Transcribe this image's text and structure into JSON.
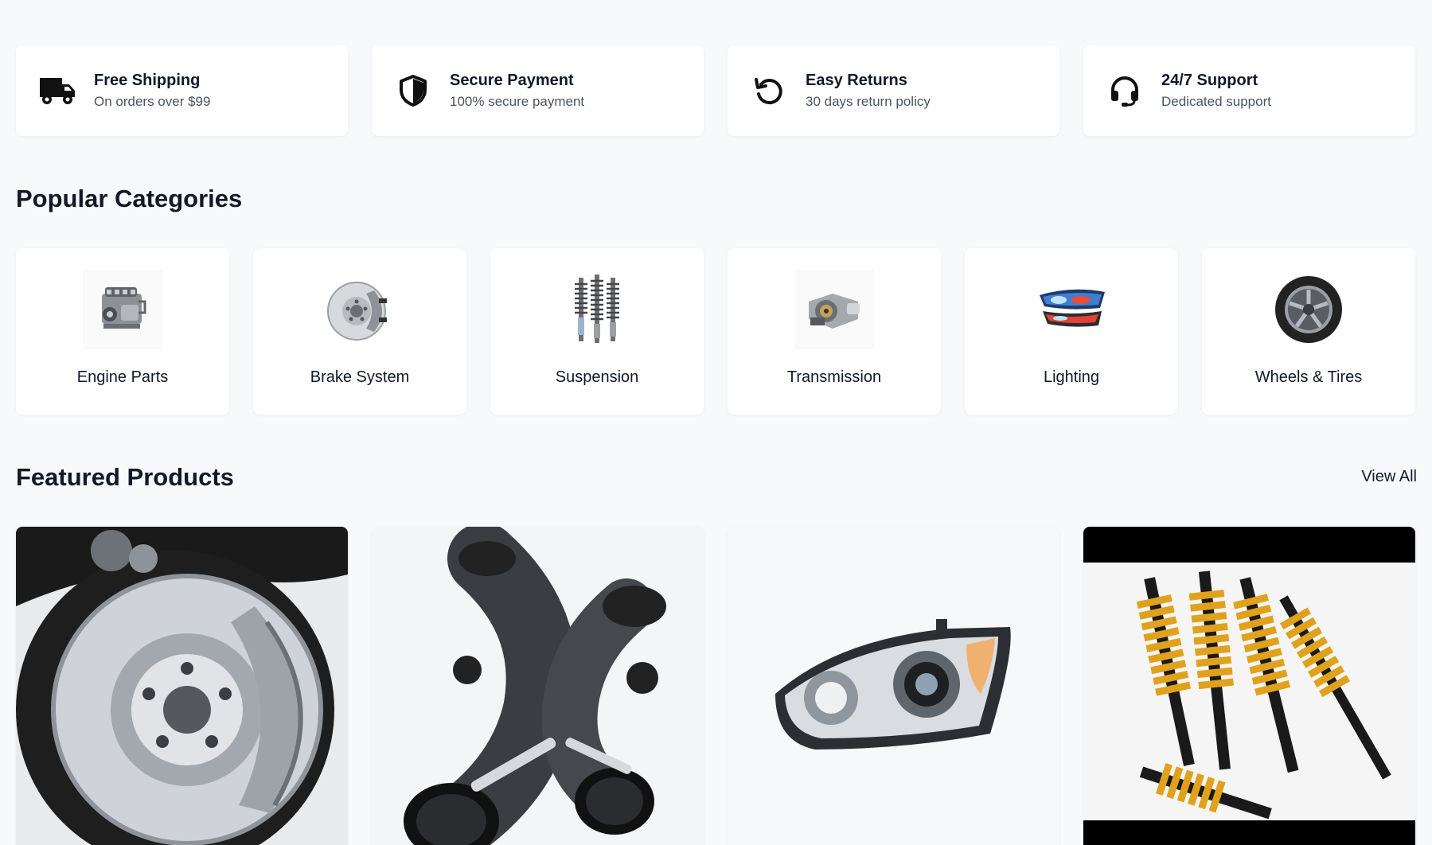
{
  "features": [
    {
      "icon": "truck-icon",
      "title": "Free Shipping",
      "subtitle": "On orders over $99"
    },
    {
      "icon": "shield-icon",
      "title": "Secure Payment",
      "subtitle": "100% secure payment"
    },
    {
      "icon": "return-icon",
      "title": "Easy Returns",
      "subtitle": "30 days return policy"
    },
    {
      "icon": "headset-icon",
      "title": "24/7 Support",
      "subtitle": "Dedicated support"
    }
  ],
  "categories_section": {
    "title": "Popular Categories",
    "items": [
      {
        "label": "Engine Parts",
        "image": "engine-image"
      },
      {
        "label": "Brake System",
        "image": "brake-rotor-image"
      },
      {
        "label": "Suspension",
        "image": "shock-absorbers-image"
      },
      {
        "label": "Transmission",
        "image": "transmission-image"
      },
      {
        "label": "Lighting",
        "image": "headlight-image"
      },
      {
        "label": "Wheels & Tires",
        "image": "wheel-image"
      }
    ]
  },
  "featured_section": {
    "title": "Featured Products",
    "view_all_label": "View All",
    "products": [
      {
        "image": "brake-disc-caliper-image"
      },
      {
        "image": "carbon-intake-pipe-image"
      },
      {
        "image": "headlight-assembly-image"
      },
      {
        "image": "coilover-kit-image"
      }
    ]
  }
}
